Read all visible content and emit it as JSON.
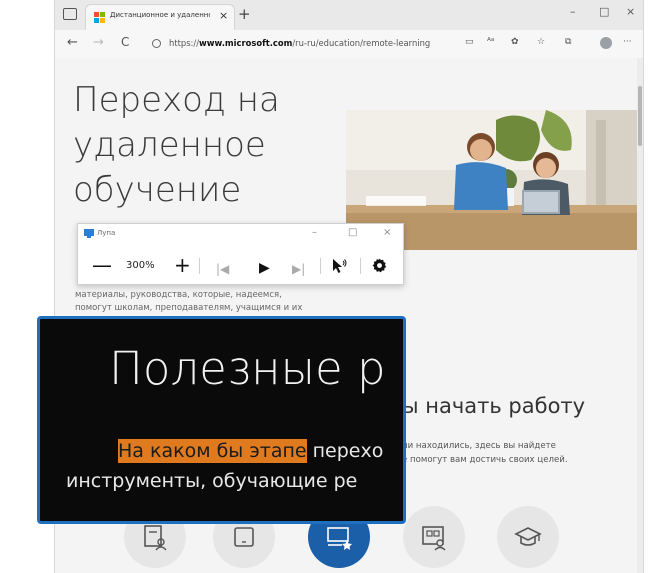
{
  "browser": {
    "tab_title": "Дистанционное и удаленное о",
    "tab_close": "×",
    "new_tab": "+",
    "win_minimize": "–",
    "win_maximize": "□",
    "win_close": "×",
    "nav_back": "←",
    "nav_forward": "→",
    "nav_reload": "C",
    "url_prefix": "https://",
    "url_domain": "www.microsoft.com",
    "url_path": "/ru-ru/education/remote-learning",
    "tool_more": "···",
    "brand_colors": [
      "#f25022",
      "#7fba00",
      "#00a4ef",
      "#ffb900"
    ]
  },
  "page": {
    "hero_title_line1": "Переход на",
    "hero_title_line2": "удаленное",
    "hero_title_line3": "обучение",
    "hero_body_line1": "материалы, руководства, которые, надеемся,",
    "hero_body_line2": "помогут школам, преподавателям, учащимся и их",
    "section_heading": "ы начать работу",
    "section_body_line1": "ни находились, здесь вы найдете",
    "section_body_line2": "е помогут вам достичь своих целей.",
    "category_icons": [
      "student-icon",
      "tablet-icon",
      "teacher-icon",
      "school-icon",
      "graduation-cap-icon"
    ],
    "accent_color": "#1a5fa8"
  },
  "magnifier": {
    "title": "Лупа",
    "minimize": "–",
    "maximize": "□",
    "close": "×",
    "zoom_out": "—",
    "zoom_level": "300%",
    "zoom_in": "+",
    "prev": "|◀",
    "play": "▶",
    "next": "▶|",
    "lens_heading": "Полезные р",
    "lens_highlight": "На каком бы этапе",
    "lens_line1_rest": " перехо",
    "lens_line2": "инструменты, обучающие ре",
    "highlight_color": "#e07a1e",
    "border_color": "#1f6fc1"
  }
}
